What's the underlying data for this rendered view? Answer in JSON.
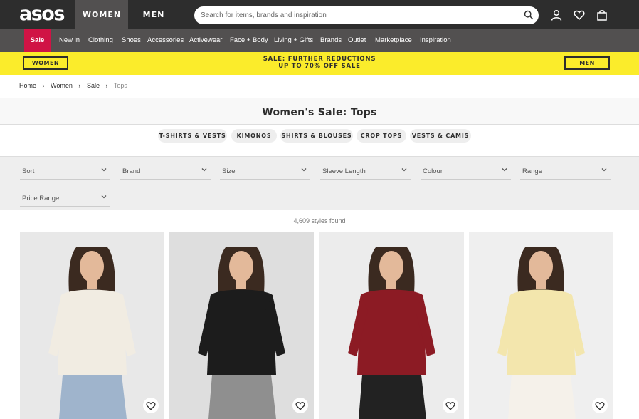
{
  "header": {
    "logo": "asos",
    "gender_tabs": [
      "WOMEN",
      "MEN"
    ],
    "search_placeholder": "Search for items, brands and inspiration",
    "icons": [
      "search-icon",
      "account-icon",
      "saved-items-icon",
      "bag-icon"
    ]
  },
  "nav": {
    "items": [
      "Sale",
      "New in",
      "Clothing",
      "Shoes",
      "Accessories",
      "Activewear",
      "Face + Body",
      "Living + Gifts",
      "Brands",
      "Outlet",
      "Marketplace",
      "Inspiration"
    ]
  },
  "banner": {
    "left_button": "WOMEN",
    "line1": "SALE: FURTHER REDUCTIONS",
    "line2": "UP TO 70% OFF SALE",
    "right_button": "MEN"
  },
  "breadcrumb": [
    "Home",
    "›",
    "Women",
    "›",
    "Sale",
    "›",
    "Tops"
  ],
  "page_title": "Women's Sale: Tops",
  "categories": [
    "T-SHIRTS & VESTS",
    "KIMONOS",
    "SHIRTS & BLOUSES",
    "CROP TOPS",
    "VESTS & CAMIS"
  ],
  "filters": [
    "Sort",
    "Brand",
    "Size",
    "Sleeve Length",
    "Colour",
    "Range",
    "Price Range"
  ],
  "results_count": "4,609 styles found",
  "products": [
    {
      "name": "product-white-crochet-top",
      "top_color": "#f1ece2",
      "bottom_color": "#9fb4cc",
      "bg": "#e8e8e8"
    },
    {
      "name": "product-black-tshirt",
      "top_color": "#1c1c1c",
      "bottom_color": "#8f8f8f",
      "bg": "#dedede"
    },
    {
      "name": "product-burgundy-blouse",
      "top_color": "#8c1b24",
      "bottom_color": "#222222",
      "bg": "#ececec"
    },
    {
      "name": "product-yellow-jacket",
      "top_color": "#f3e6ad",
      "bottom_color": "#f5f1ea",
      "bg": "#efefef"
    }
  ],
  "colors": {
    "topbar": "#2d2d2d",
    "navbar": "#525050",
    "sale": "#d01345",
    "banner": "#fbec2b"
  }
}
